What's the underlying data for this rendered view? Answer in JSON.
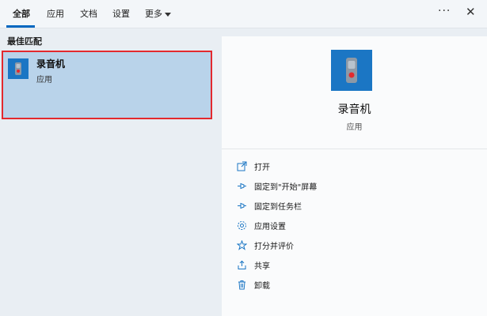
{
  "tabs": [
    {
      "label": "全部",
      "active": true
    },
    {
      "label": "应用"
    },
    {
      "label": "文档"
    },
    {
      "label": "设置"
    },
    {
      "label": "更多"
    }
  ],
  "topbar": {
    "more_glyph": "···",
    "close_glyph": "✕"
  },
  "results": {
    "section_title": "最佳匹配",
    "best_match": {
      "name": "录音机",
      "type": "应用",
      "icon": "voice-recorder-icon"
    }
  },
  "detail": {
    "name": "录音机",
    "type": "应用",
    "icon": "voice-recorder-icon",
    "actions": [
      {
        "label": "打开",
        "icon": "open-icon"
      },
      {
        "label": "固定到\"开始\"屏幕",
        "icon": "pin-icon"
      },
      {
        "label": "固定到任务栏",
        "icon": "pin-icon"
      },
      {
        "label": "应用设置",
        "icon": "gear-icon"
      },
      {
        "label": "打分并评价",
        "icon": "star-icon"
      },
      {
        "label": "共享",
        "icon": "share-icon"
      },
      {
        "label": "卸载",
        "icon": "trash-icon"
      }
    ]
  },
  "colors": {
    "accent": "#1b76c4",
    "selection": "#b9d3ea",
    "highlight_border": "#e3292e"
  }
}
